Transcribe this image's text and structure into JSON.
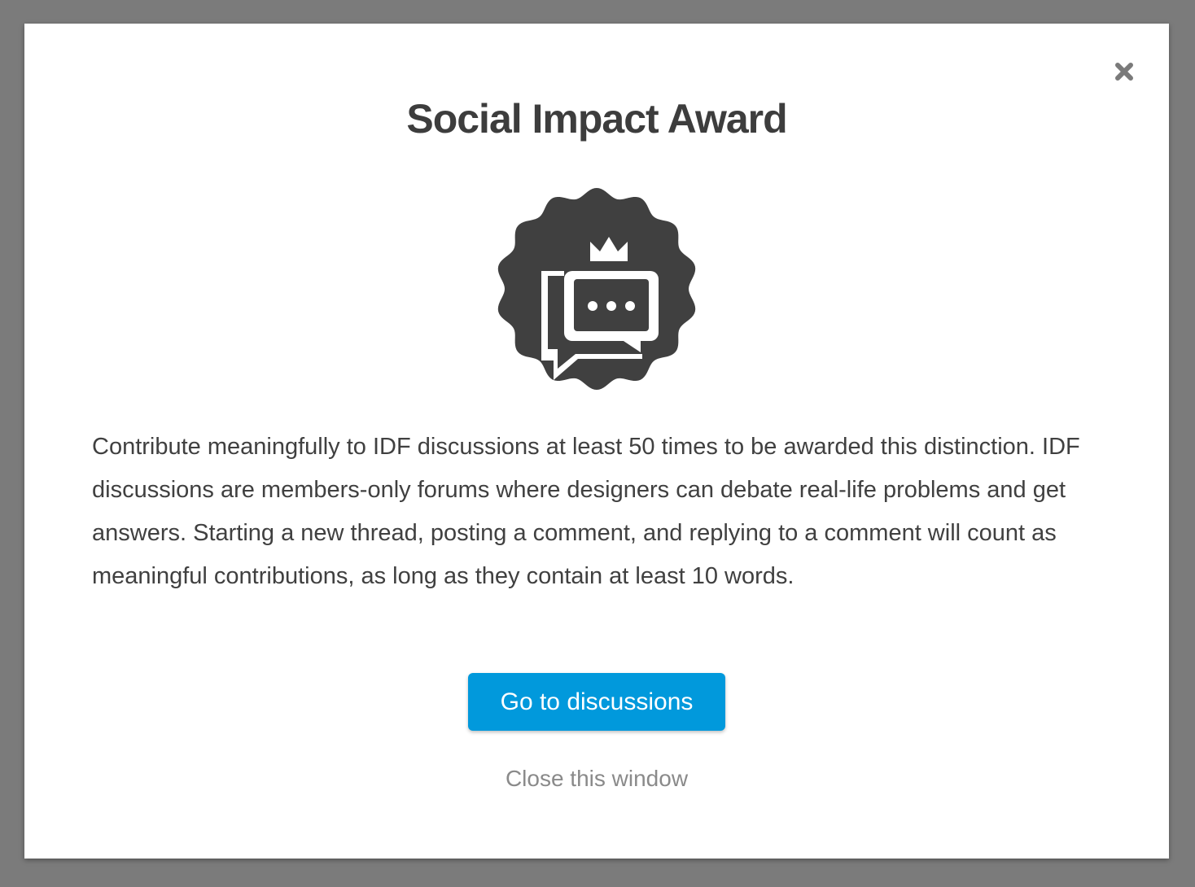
{
  "colors": {
    "backdrop": "#7b7b7b",
    "modal_background": "#ffffff",
    "text_dark": "#3d3d3d",
    "badge": "#404040",
    "primary_button": "#0199dc",
    "link_muted": "#8a8a8a",
    "close_icon": "#7a7a7a"
  },
  "modal": {
    "title": "Social Impact Award",
    "badge_icon": "chat-bubbles-crown-badge-icon",
    "close_icon": "close-icon",
    "description": "Contribute meaningfully to IDF discussions at least 50 times to be awarded this distinction. IDF discussions are members-only forums where designers can debate real-life problems and get answers. Starting a new thread, posting a comment, and replying to a comment will count as meaningful contributions, as long as they contain at least 10 words.",
    "primary_button_label": "Go to discussions",
    "close_link_label": "Close this window"
  }
}
